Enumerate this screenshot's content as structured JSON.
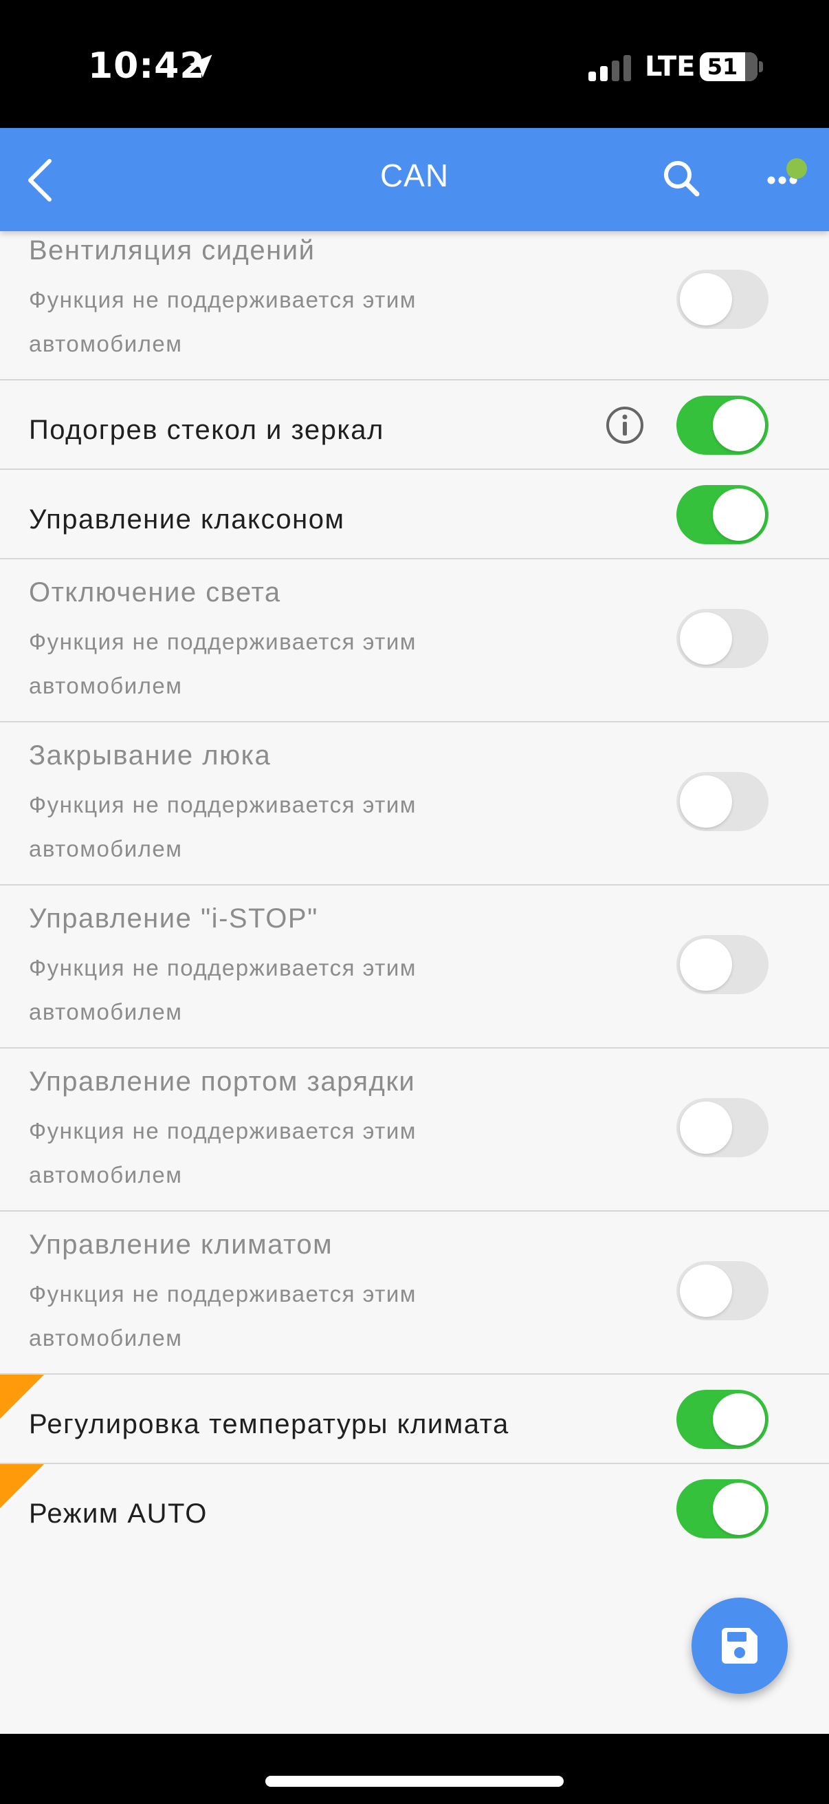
{
  "status_bar": {
    "time": "10:42",
    "network": "LTE",
    "battery": "51"
  },
  "app_bar": {
    "title": "CAN"
  },
  "rows": [
    {
      "title": "Вентиляция сидений",
      "subtitle": "Функция не поддерживается этим автомобилем",
      "enabled": false,
      "on": false
    },
    {
      "title": "Подогрев стекол и зеркал",
      "enabled": true,
      "on": true,
      "info": true
    },
    {
      "title": "Управление клаксоном",
      "enabled": true,
      "on": true
    },
    {
      "title": "Отключение света",
      "subtitle": "Функция не поддерживается этим автомобилем",
      "enabled": false,
      "on": false
    },
    {
      "title": "Закрывание люка",
      "subtitle": "Функция не поддерживается этим автомобилем",
      "enabled": false,
      "on": false
    },
    {
      "title": "Управление \"i-STOP\"",
      "subtitle": "Функция не поддерживается этим автомобилем",
      "enabled": false,
      "on": false
    },
    {
      "title": "Управление портом зарядки",
      "subtitle": "Функция не поддерживается этим автомобилем",
      "enabled": false,
      "on": false
    },
    {
      "title": "Управление климатом",
      "subtitle": "Функция не поддерживается этим автомобилем",
      "enabled": false,
      "on": false
    },
    {
      "title": "Регулировка температуры климата",
      "enabled": true,
      "on": true,
      "flag": true
    },
    {
      "title": "Режим AUTO",
      "enabled": true,
      "on": true,
      "flag": true
    }
  ],
  "colors": {
    "accent": "#4b8ff0",
    "toggle_on": "#35c13b",
    "toggle_off": "#e3e3e3",
    "flag": "#ff9a0a",
    "notification_dot": "#8bc34a"
  },
  "icons": {
    "back": "chevron-left-icon",
    "search": "search-icon",
    "more": "more-horizontal-icon",
    "info": "info-icon",
    "save": "floppy-disk-icon",
    "location": "location-arrow-icon"
  }
}
